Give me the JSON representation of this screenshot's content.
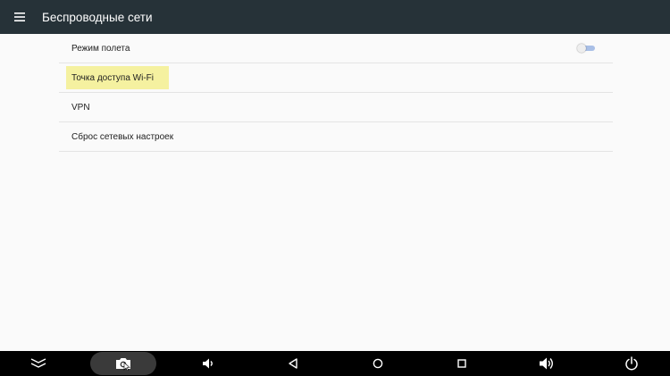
{
  "app_bar": {
    "title": "Беспроводные сети",
    "menu_icon": "menu-icon",
    "color": "#263238"
  },
  "settings": {
    "items": [
      {
        "label": "Режим полета",
        "has_toggle": true,
        "toggle_on": false
      },
      {
        "label": "Точка доступа Wi-Fi",
        "highlighted": true
      },
      {
        "label": "VPN"
      },
      {
        "label": "Сброс сетевых настроек"
      }
    ],
    "highlight_color": "#f5f1a0",
    "toggle_track_color": "#a9bfe6"
  },
  "nav_bar": {
    "buttons": [
      "collapse-icon",
      "screenshot-icon",
      "volume-down-icon",
      "back-icon",
      "home-icon",
      "recents-icon",
      "volume-up-icon",
      "power-icon"
    ]
  }
}
